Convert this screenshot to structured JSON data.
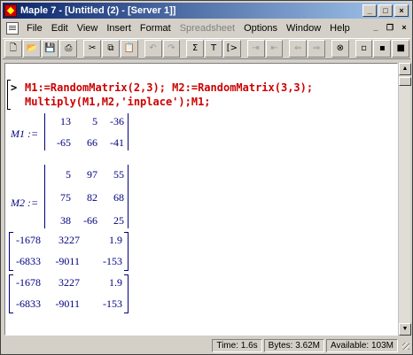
{
  "window": {
    "title": "Maple 7 - [Untitled (2) - [Server 1]]"
  },
  "title_buttons": {
    "minimize": "_",
    "maximize": "□",
    "close": "×"
  },
  "menu": {
    "items": [
      {
        "label": "File",
        "enabled": true
      },
      {
        "label": "Edit",
        "enabled": true
      },
      {
        "label": "View",
        "enabled": true
      },
      {
        "label": "Insert",
        "enabled": true
      },
      {
        "label": "Format",
        "enabled": true
      },
      {
        "label": "Spreadsheet",
        "enabled": false
      },
      {
        "label": "Options",
        "enabled": true
      },
      {
        "label": "Window",
        "enabled": true
      },
      {
        "label": "Help",
        "enabled": true
      }
    ],
    "doc_buttons": {
      "minimize": "_",
      "restore": "❐",
      "close": "×"
    }
  },
  "toolbar": {
    "groups": [
      [
        {
          "icon": "new-icon",
          "glyph": "🗋"
        },
        {
          "icon": "open-icon",
          "glyph": "📂"
        },
        {
          "icon": "save-icon",
          "glyph": "💾"
        },
        {
          "icon": "print-icon",
          "glyph": "⎙"
        }
      ],
      [
        {
          "icon": "cut-icon",
          "glyph": "✂"
        },
        {
          "icon": "copy-icon",
          "glyph": "⧉"
        },
        {
          "icon": "paste-icon",
          "glyph": "📋"
        }
      ],
      [
        {
          "icon": "undo-icon",
          "glyph": "↶",
          "disabled": true
        },
        {
          "icon": "redo-icon",
          "glyph": "↷",
          "disabled": true
        }
      ],
      [
        {
          "icon": "sigma-icon",
          "glyph": "Σ"
        },
        {
          "icon": "text-icon",
          "glyph": "T"
        },
        {
          "icon": "execute-group-icon",
          "glyph": "[>"
        }
      ],
      [
        {
          "icon": "indent-icon",
          "glyph": "⇥",
          "disabled": true
        },
        {
          "icon": "outdent-icon",
          "glyph": "⇤",
          "disabled": true
        }
      ],
      [
        {
          "icon": "back-icon",
          "glyph": "⇐",
          "disabled": true
        },
        {
          "icon": "forward-icon",
          "glyph": "⇒",
          "disabled": true
        }
      ],
      [
        {
          "icon": "stop-icon",
          "glyph": "⊗"
        }
      ],
      [
        {
          "icon": "zoom-small-icon",
          "glyph": "▫"
        },
        {
          "icon": "zoom-medium-icon",
          "glyph": "▪"
        },
        {
          "icon": "zoom-large-icon",
          "glyph": "■"
        }
      ]
    ]
  },
  "worksheet": {
    "prompt": ">",
    "input_lines": [
      "M1:=RandomMatrix(2,3); M2:=RandomMatrix(3,3);",
      "Multiply(M1,M2,'inplace');M1;"
    ],
    "outputs": {
      "m1_label": "M1 :=",
      "m1": [
        [
          "13",
          "5",
          "-36"
        ],
        [
          "-65",
          "66",
          "-41"
        ]
      ],
      "m2_label": "M2 :=",
      "m2": [
        [
          "5",
          "97",
          "55"
        ],
        [
          "75",
          "82",
          "68"
        ],
        [
          "38",
          "-66",
          "25"
        ]
      ],
      "result1": [
        [
          "-1678",
          "3227",
          "1.9"
        ],
        [
          "-6833",
          "-9011",
          "-153"
        ]
      ],
      "result2": [
        [
          "-1678",
          "3227",
          "1.9"
        ],
        [
          "-6833",
          "-9011",
          "-153"
        ]
      ]
    }
  },
  "status": {
    "time": "Time: 1.6s",
    "bytes": "Bytes: 3.62M",
    "available": "Available: 103M"
  }
}
